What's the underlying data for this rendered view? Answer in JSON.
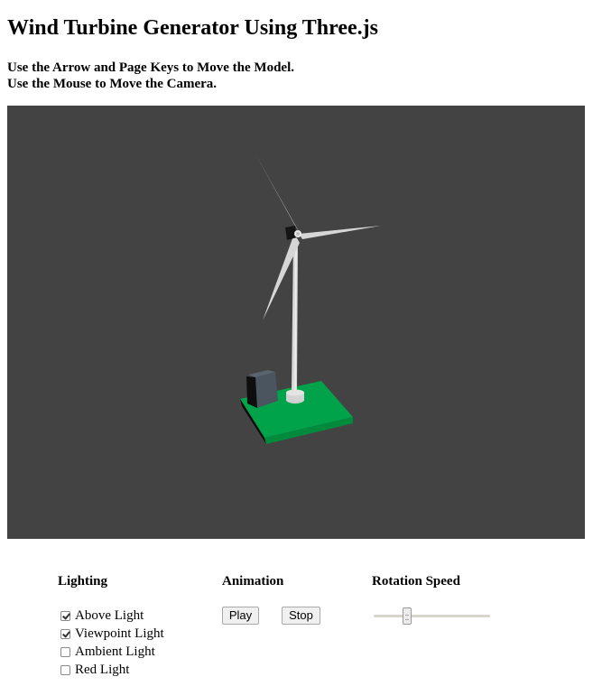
{
  "page": {
    "title": "Wind Turbine Generator Using Three.js",
    "instructions": [
      "Use the Arrow and Page Keys to Move the Model.",
      "Use the Mouse to Move the Camera."
    ]
  },
  "scene": {
    "background_color": "#434343",
    "base_color": "#00a349",
    "tower_color": "#d9d9d9",
    "blade_color": "#d6d6d6",
    "box_color": "#4a5560"
  },
  "controls": {
    "lighting": {
      "heading": "Lighting",
      "options": [
        {
          "label": "Above Light",
          "checked": true
        },
        {
          "label": "Viewpoint Light",
          "checked": true
        },
        {
          "label": "Ambient Light",
          "checked": false
        },
        {
          "label": "Red Light",
          "checked": false
        }
      ]
    },
    "animation": {
      "heading": "Animation",
      "play_label": "Play",
      "stop_label": "Stop"
    },
    "rotation_speed": {
      "heading": "Rotation Speed",
      "value_fraction": 0.27
    }
  }
}
